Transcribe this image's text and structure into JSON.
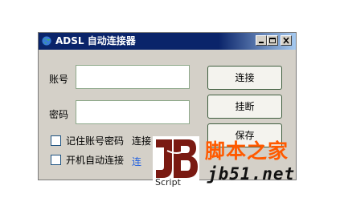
{
  "window": {
    "title": "ADSL 自动连接器"
  },
  "form": {
    "account_label": "账号",
    "password_label": "密码",
    "account_value": "",
    "password_value": "",
    "remember_label": "记住账号密码",
    "remember_suffix": "连接",
    "autostart_label": "开机自动连接",
    "autostart_suffix": "连"
  },
  "buttons": {
    "connect": "连接",
    "disconnect": "挂断",
    "save": "保存"
  },
  "watermark": {
    "brand_cn": "脚本之家",
    "url": "jb51.net",
    "script": "Script"
  },
  "colors": {
    "titlebar": "#0a246a",
    "window_bg": "#d4d0c8",
    "watermark_orange": "#ff5a00"
  }
}
